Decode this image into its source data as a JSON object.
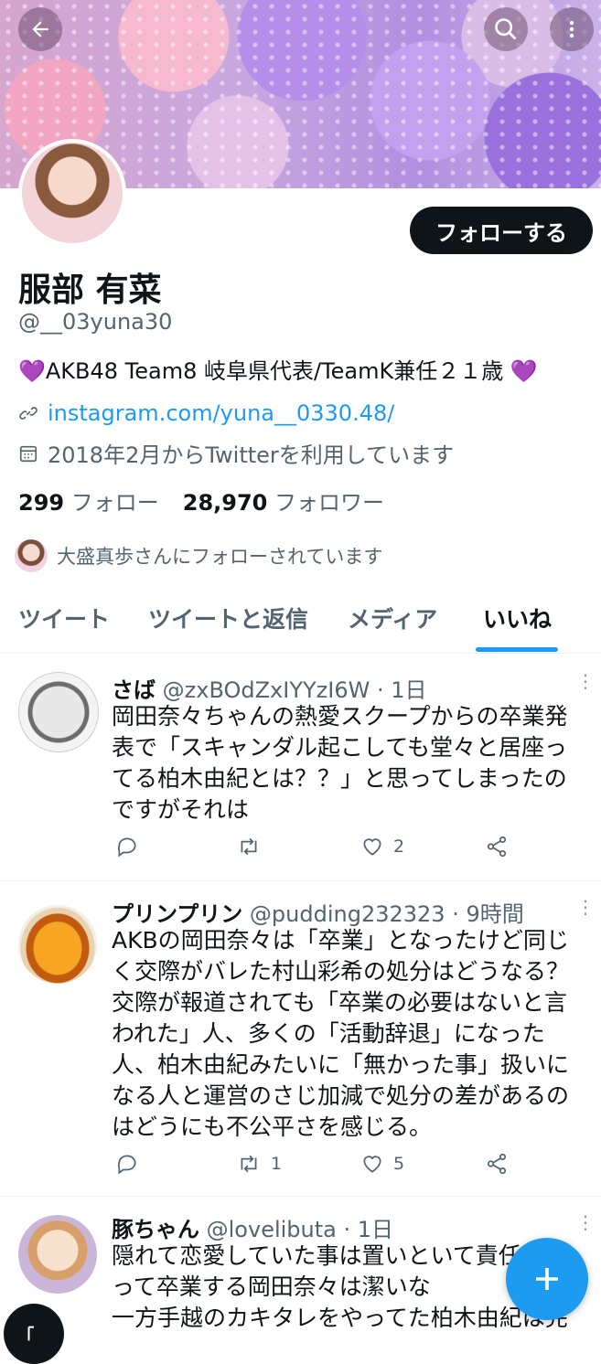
{
  "profile": {
    "name": "服部 有菜",
    "handle": "@__03yuna30",
    "bio": "💜AKB48 Team8 岐阜県代表/TeamK兼任２１歳 💜",
    "link": "instagram.com/yuna__0330.48/",
    "joined": "2018年2月からTwitterを利用しています",
    "following_count": "299",
    "following_label": "フォロー",
    "followers_count": "28,970",
    "followers_label": "フォロワー",
    "followed_by": "大盛真歩さんにフォローされています",
    "follow_button": "フォローする"
  },
  "tabs": [
    {
      "label": "ツイート"
    },
    {
      "label": "ツイートと返信"
    },
    {
      "label": "メディア"
    },
    {
      "label": "いいね",
      "active": true
    }
  ],
  "tweets": [
    {
      "name": "さば",
      "handle": "@zxBOdZxIYYzI6W · 1日",
      "lines": [
        "岡田奈々ちゃんの熱愛スクープからの卒業発",
        "表で「スキャンダル起こしても堂々と居座っ",
        "てる柏木由紀とは？？」と思ってしまったの",
        "ですがそれは"
      ],
      "retweets": "",
      "likes": "2"
    },
    {
      "name": "プリンプリン",
      "handle": "@pudding232323 · 9時間",
      "lines": [
        "AKBの岡田奈々は「卒業」となったけど同じ",
        "く交際がバレた村山彩希の処分はどうなる？",
        "交際が報道されても「卒業の必要はないと言",
        "われた」人、多くの「活動辞退」になった",
        "人、柏木由紀みたいに「無かった事」扱いに",
        "なる人と運営のさじ加減で処分の差があるの",
        "はどうにも不公平さを感じる。"
      ],
      "retweets": "1",
      "likes": "5"
    },
    {
      "name": "豚ちゃん",
      "handle": "@lovelibuta · 1日",
      "lines": [
        "隠れて恋愛していた事は置いといて責任を取",
        "って卒業する岡田奈々は潔いな",
        "一方手越のカキタレをやってた柏木由紀は完"
      ]
    }
  ],
  "colors": {
    "accent": "#1d9bf0",
    "text": "#0f1419",
    "muted": "#536471"
  }
}
